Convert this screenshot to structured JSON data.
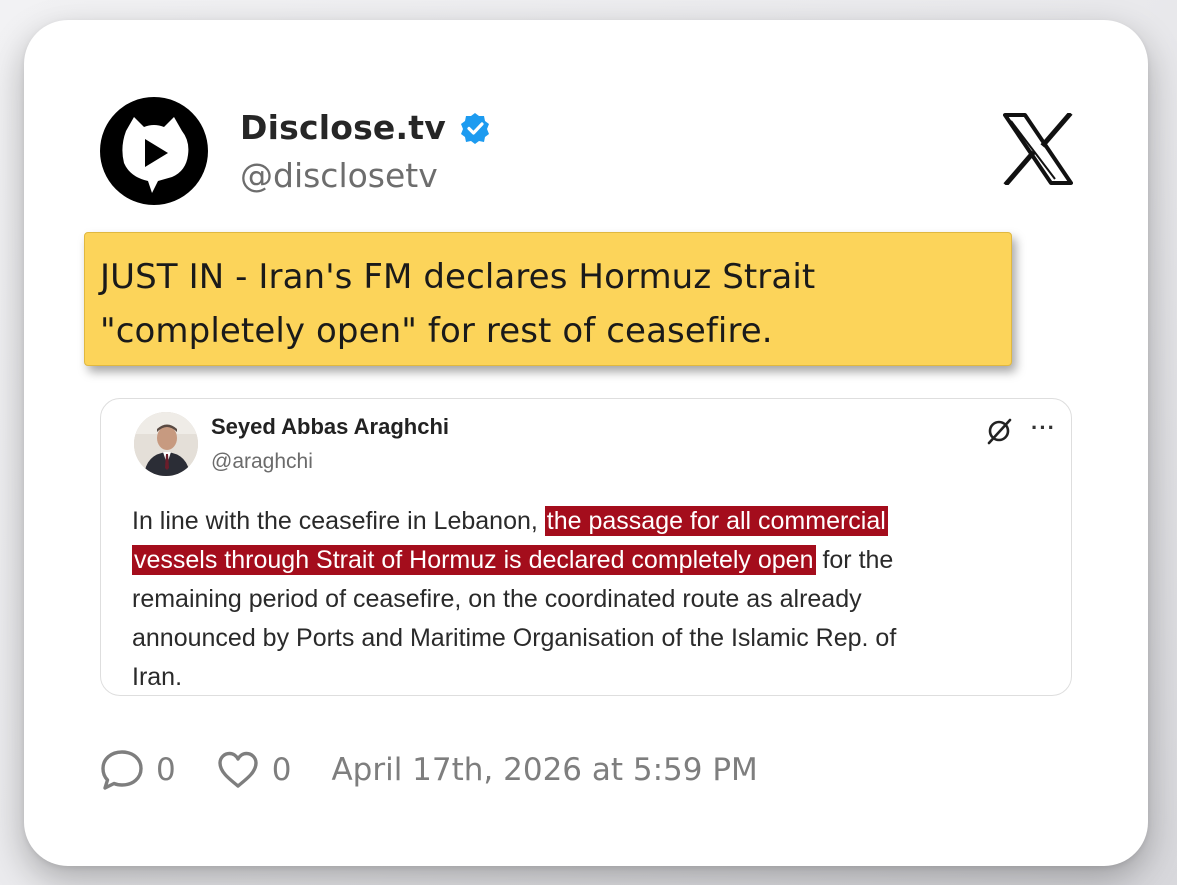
{
  "post": {
    "author_name": "Disclose.tv",
    "author_handle": "@disclosetv",
    "headline_line1": "JUST IN - Iran's FM declares Hormuz Strait",
    "headline_line2": "\"completely open\" for rest of ceasefire.",
    "reply_count": "0",
    "like_count": "0",
    "timestamp": "April 17th, 2026 at 5:59 PM"
  },
  "quoted_post": {
    "author_name": "Seyed Abbas Araghchi",
    "author_handle": "@araghchi",
    "more_label": "···",
    "lines": {
      "r1_plain": "In line with the ceasefire in Lebanon, ",
      "r1_highlight": "the passage for all commercial",
      "r2_highlight": "vessels through Strait of Hormuz is declared completely open",
      "r2_plain": " for the",
      "r3": "remaining period of ceasefire, on the coordinated route as already",
      "r4": "announced by Ports and Maritime Organisation of the Islamic Rep. of",
      "r5": "Iran."
    }
  },
  "colors": {
    "headline_bg": "#fcd45a",
    "highlight_bg": "#a40d1c",
    "verified_blue": "#1d9bf0"
  },
  "icons": {
    "avatar": "disclose-logo-icon",
    "verified": "verified-badge-icon",
    "platform": "x-logo-icon",
    "grok": "grok-icon",
    "reply": "reply-icon",
    "like": "heart-icon"
  }
}
